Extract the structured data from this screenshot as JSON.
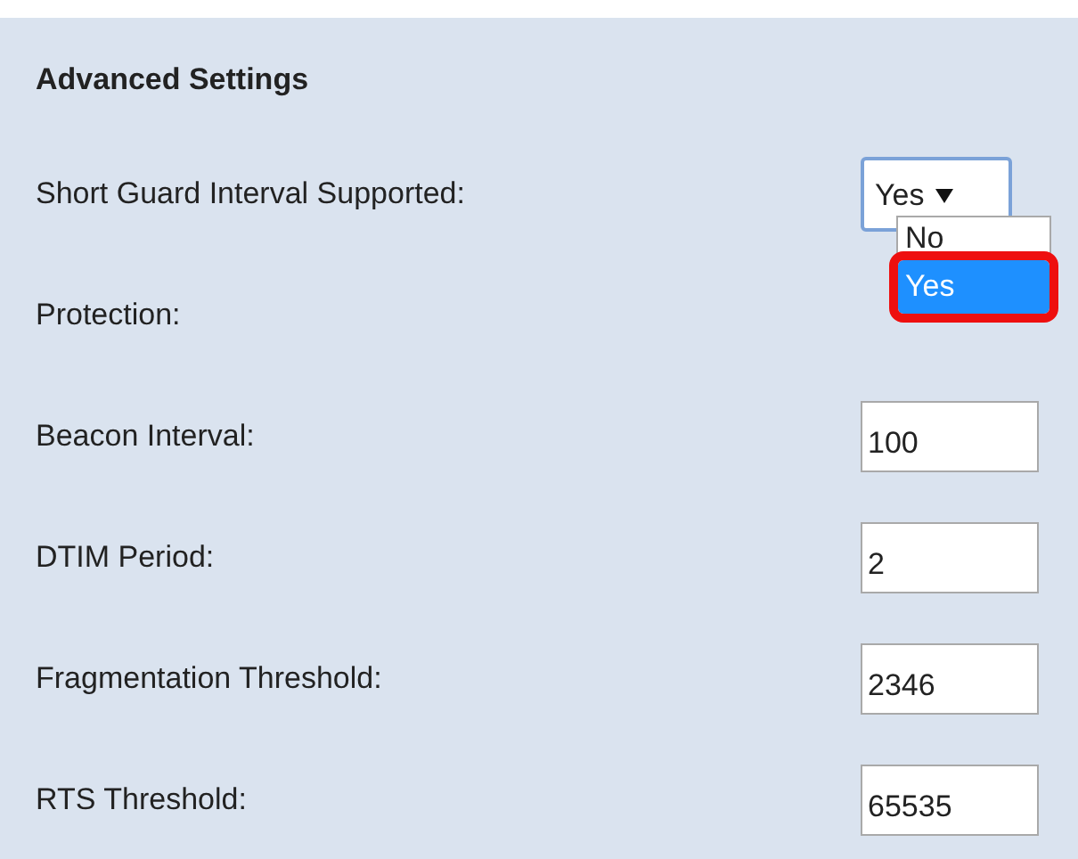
{
  "section": {
    "title": "Advanced Settings"
  },
  "settings": [
    {
      "label": "Short Guard Interval Supported:",
      "kind": "select",
      "value": "Yes",
      "expanded": true,
      "options": [
        {
          "label": "No",
          "selected": false
        },
        {
          "label": "Yes",
          "selected": true
        }
      ]
    },
    {
      "label": "Protection:",
      "kind": "hidden"
    },
    {
      "label": "Beacon Interval:",
      "kind": "text",
      "value": "100"
    },
    {
      "label": "DTIM Period:",
      "kind": "text",
      "value": "2"
    },
    {
      "label": "Fragmentation Threshold:",
      "kind": "text",
      "value": "2346"
    },
    {
      "label": "RTS Threshold:",
      "kind": "text",
      "value": "65535"
    }
  ]
}
